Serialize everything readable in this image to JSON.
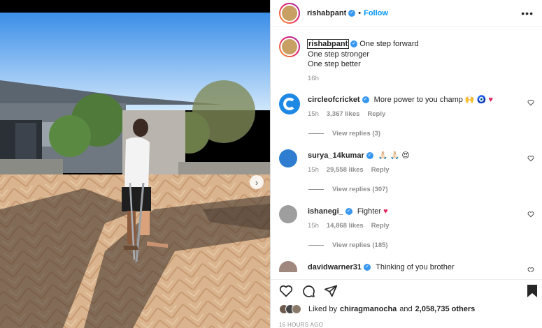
{
  "post": {
    "author": "rishabpant",
    "follow_label": "Follow",
    "dot": "•",
    "caption_lines": [
      "One step forward",
      "One step stronger",
      "One step better"
    ],
    "caption_time": "16h",
    "verified_glyph": "✓",
    "more_glyph": "•••",
    "next_glyph": "›"
  },
  "comments": [
    {
      "user": "circleofcricket",
      "text": "More power to you champ 🙌 🧿",
      "heart": "♥",
      "time": "15h",
      "likes": "3,367 likes",
      "reply": "Reply",
      "view_replies": "View replies (3)",
      "avatar_color": "#1e88e5"
    },
    {
      "user": "surya_14kumar",
      "text": "🙏🏻 🙏🏻 😍",
      "time": "15h",
      "likes": "29,558 likes",
      "reply": "Reply",
      "view_replies": "View replies (307)",
      "avatar_color": "#2e7dd1"
    },
    {
      "user": "ishanegi_",
      "text": "Fighter",
      "heart": "♥",
      "time": "15h",
      "likes": "14,868 likes",
      "reply": "Reply",
      "view_replies": "View replies (185)",
      "avatar_color": "#9e9e9e"
    },
    {
      "user": "davidwarner31",
      "text": "Thinking of you brother",
      "avatar_color": "#a1887f"
    }
  ],
  "likes": {
    "prefix": "Liked by",
    "user": "chiragmanocha",
    "mid": "and",
    "count": "2,058,735 others"
  },
  "timestamp": "16 HOURS AGO",
  "colors": {
    "accent": "#0095f6",
    "verified": "#3897f0",
    "heart": "#e0245e"
  },
  "icons": [
    "heart-icon",
    "comment-icon",
    "share-icon",
    "bookmark-icon",
    "more-icon",
    "chevron-right-icon",
    "verified-badge-icon"
  ]
}
